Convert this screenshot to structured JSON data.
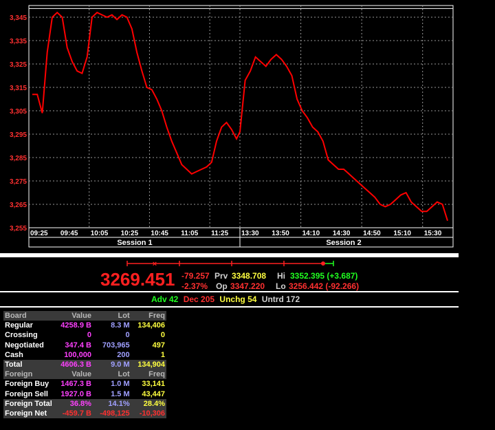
{
  "chart_data": {
    "type": "line",
    "title": "",
    "ylim": [
      3255,
      3350
    ],
    "yticks": [
      "3,345",
      "3,335",
      "3,325",
      "3,315",
      "3,305",
      "3,295",
      "3,285",
      "3,275",
      "3,265",
      "3,255"
    ],
    "ytick_values": [
      3345,
      3335,
      3325,
      3315,
      3305,
      3295,
      3285,
      3275,
      3265,
      3255
    ],
    "xticks_session1": [
      "09:25",
      "09:45",
      "10:05",
      "10:25",
      "10:45",
      "11:05",
      "11:25"
    ],
    "xticks_session2": [
      "13:30",
      "13:50",
      "14:10",
      "14:30",
      "14:50",
      "15:10",
      "15:30"
    ],
    "session_labels": [
      "Session 1",
      "Session 2"
    ],
    "reference_level": 3348.708,
    "series": [
      {
        "color": "#ff0000",
        "session1": [
          3312,
          3312,
          3304,
          3330,
          3345,
          3347,
          3345,
          3332,
          3326,
          3322,
          3321,
          3328,
          3345,
          3347,
          3346,
          3345,
          3346,
          3344,
          3346,
          3345,
          3340,
          3330,
          3322,
          3315,
          3314,
          3310,
          3305,
          3298,
          3292,
          3287,
          3282,
          3280,
          3278,
          3279,
          3280,
          3281,
          3283,
          3292,
          3298,
          3300,
          3297,
          3293
        ],
        "session2": [
          3296,
          3318,
          3322,
          3328,
          3326,
          3324,
          3327,
          3329,
          3327,
          3324,
          3320,
          3310,
          3305,
          3302,
          3298,
          3296,
          3292,
          3284,
          3282,
          3280,
          3280,
          3278,
          3276,
          3274,
          3272,
          3270,
          3268,
          3265,
          3264,
          3265,
          3267,
          3269,
          3270,
          3266,
          3264,
          3262,
          3262,
          3264,
          3266,
          3265,
          3258
        ]
      }
    ]
  },
  "ticker": {
    "last": "3269.451",
    "change": "-79.257",
    "change_pct": "-2.37%",
    "prv_label": "Prv",
    "prv_value": "3348.708",
    "op_label": "Op",
    "op_value": "3347.220",
    "hi_label": "Hi",
    "hi_value": "3352.395 (+3.687)",
    "lo_label": "Lo",
    "lo_value": "3256.442 (-92.266)"
  },
  "breadth": {
    "adv": "Adv 42",
    "dec": "Dec 205",
    "unchg": "Unchg 54",
    "untrd": "Untrd 172"
  },
  "board": {
    "header": [
      "Board",
      "Value",
      "Lot",
      "Freq"
    ],
    "rows": [
      {
        "label": "Regular",
        "value": "4258.9 B",
        "lot": "8.3 M",
        "freq": "134,406"
      },
      {
        "label": "Crossing",
        "value": "0",
        "lot": "0",
        "freq": "0"
      },
      {
        "label": "Negotiated",
        "value": "347.4 B",
        "lot": "703,965",
        "freq": "497"
      },
      {
        "label": "Cash",
        "value": "100,000",
        "lot": "200",
        "freq": "1"
      }
    ],
    "total": {
      "label": "Total",
      "value": "4606.3 B",
      "lot": "9.0 M",
      "freq": "134,904"
    },
    "foreign_header": [
      "Foreign",
      "Value",
      "Lot",
      "Freq"
    ],
    "foreign_rows": [
      {
        "label": "Foreign Buy",
        "value": "1467.3 B",
        "lot": "1.0 M",
        "freq": "33,141"
      },
      {
        "label": "Foreign Sell",
        "value": "1927.0 B",
        "lot": "1.5 M",
        "freq": "43,447"
      }
    ],
    "foreign_total": {
      "label": "Foreign Total",
      "value": "36.8%",
      "lot": "14.1%",
      "freq": "28.4%"
    },
    "foreign_net": {
      "label": "Foreign Net",
      "value": "-459.7 B",
      "lot": "-498,125",
      "freq": "-10,306"
    }
  }
}
